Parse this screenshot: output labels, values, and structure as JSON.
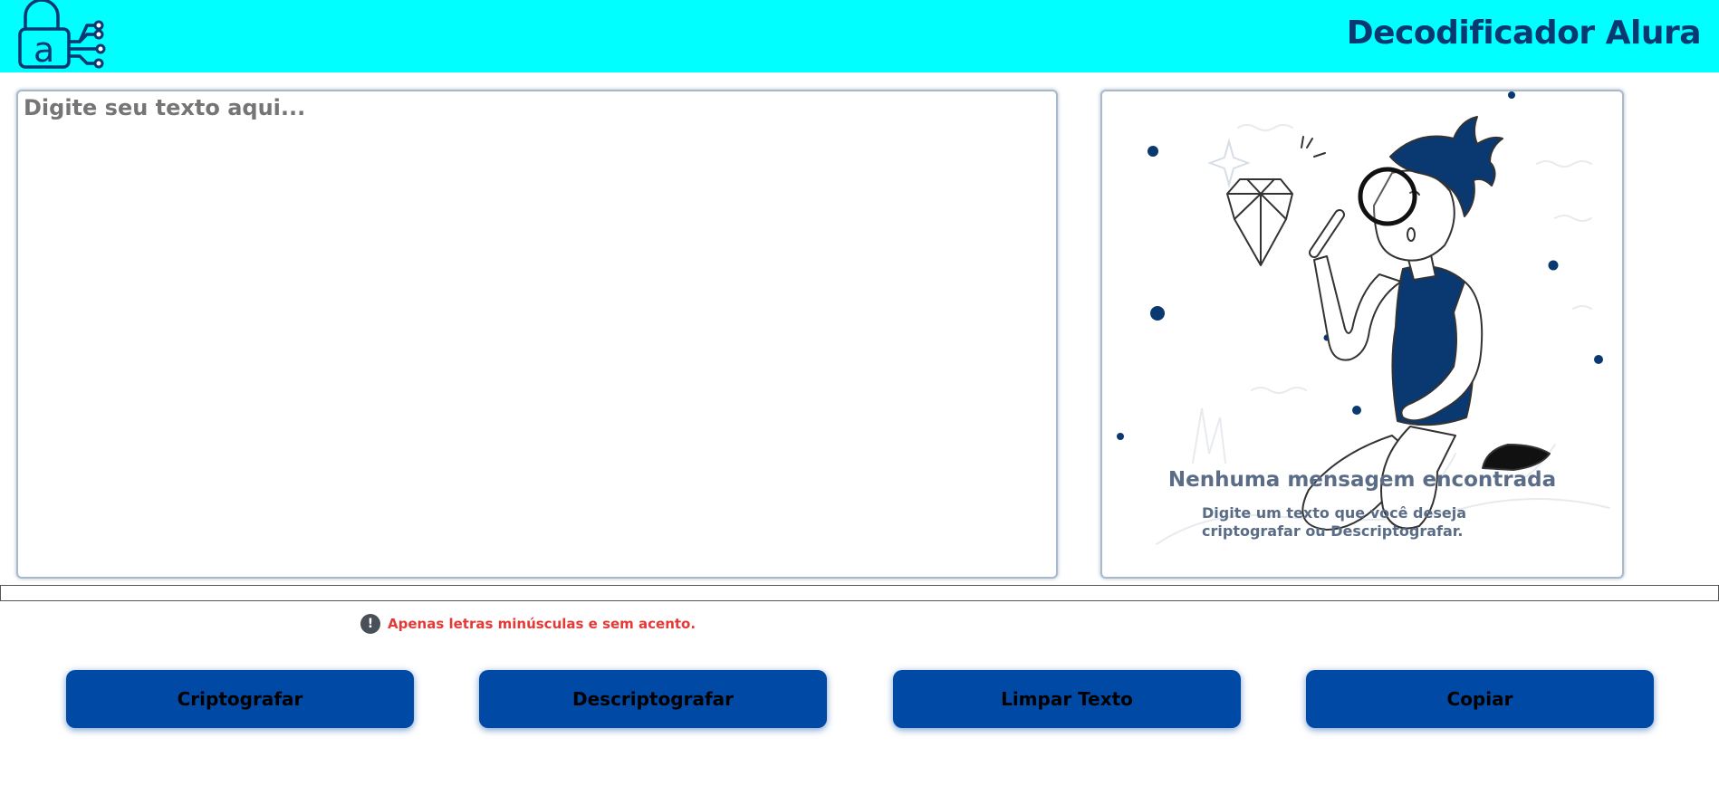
{
  "header": {
    "title": "Decodificador Alura",
    "logo_icon": "padlock-circuit-logo-icon",
    "logo_letter": "a"
  },
  "input": {
    "placeholder": "Digite seu texto aqui...",
    "value": ""
  },
  "output": {
    "illustration": "boy-with-magnifying-glass-and-diamond",
    "empty_title": "Nenhuma mensagem encontrada",
    "empty_subtitle": "Digite um texto que você deseja criptografar ou Descriptografar."
  },
  "hint": {
    "icon": "exclamation-circle-icon",
    "icon_glyph": "!",
    "text": "Apenas letras minúsculas e sem acento."
  },
  "buttons": {
    "encrypt": "Criptografar",
    "decrypt": "Descriptografar",
    "clear": "Limpar Texto",
    "copy": "Copiar"
  },
  "colors": {
    "header_bg": "#00ffff",
    "title": "#0a3871",
    "button_bg": "#0049a4",
    "hint_text": "#e53935",
    "muted_text": "#5a6c86"
  }
}
